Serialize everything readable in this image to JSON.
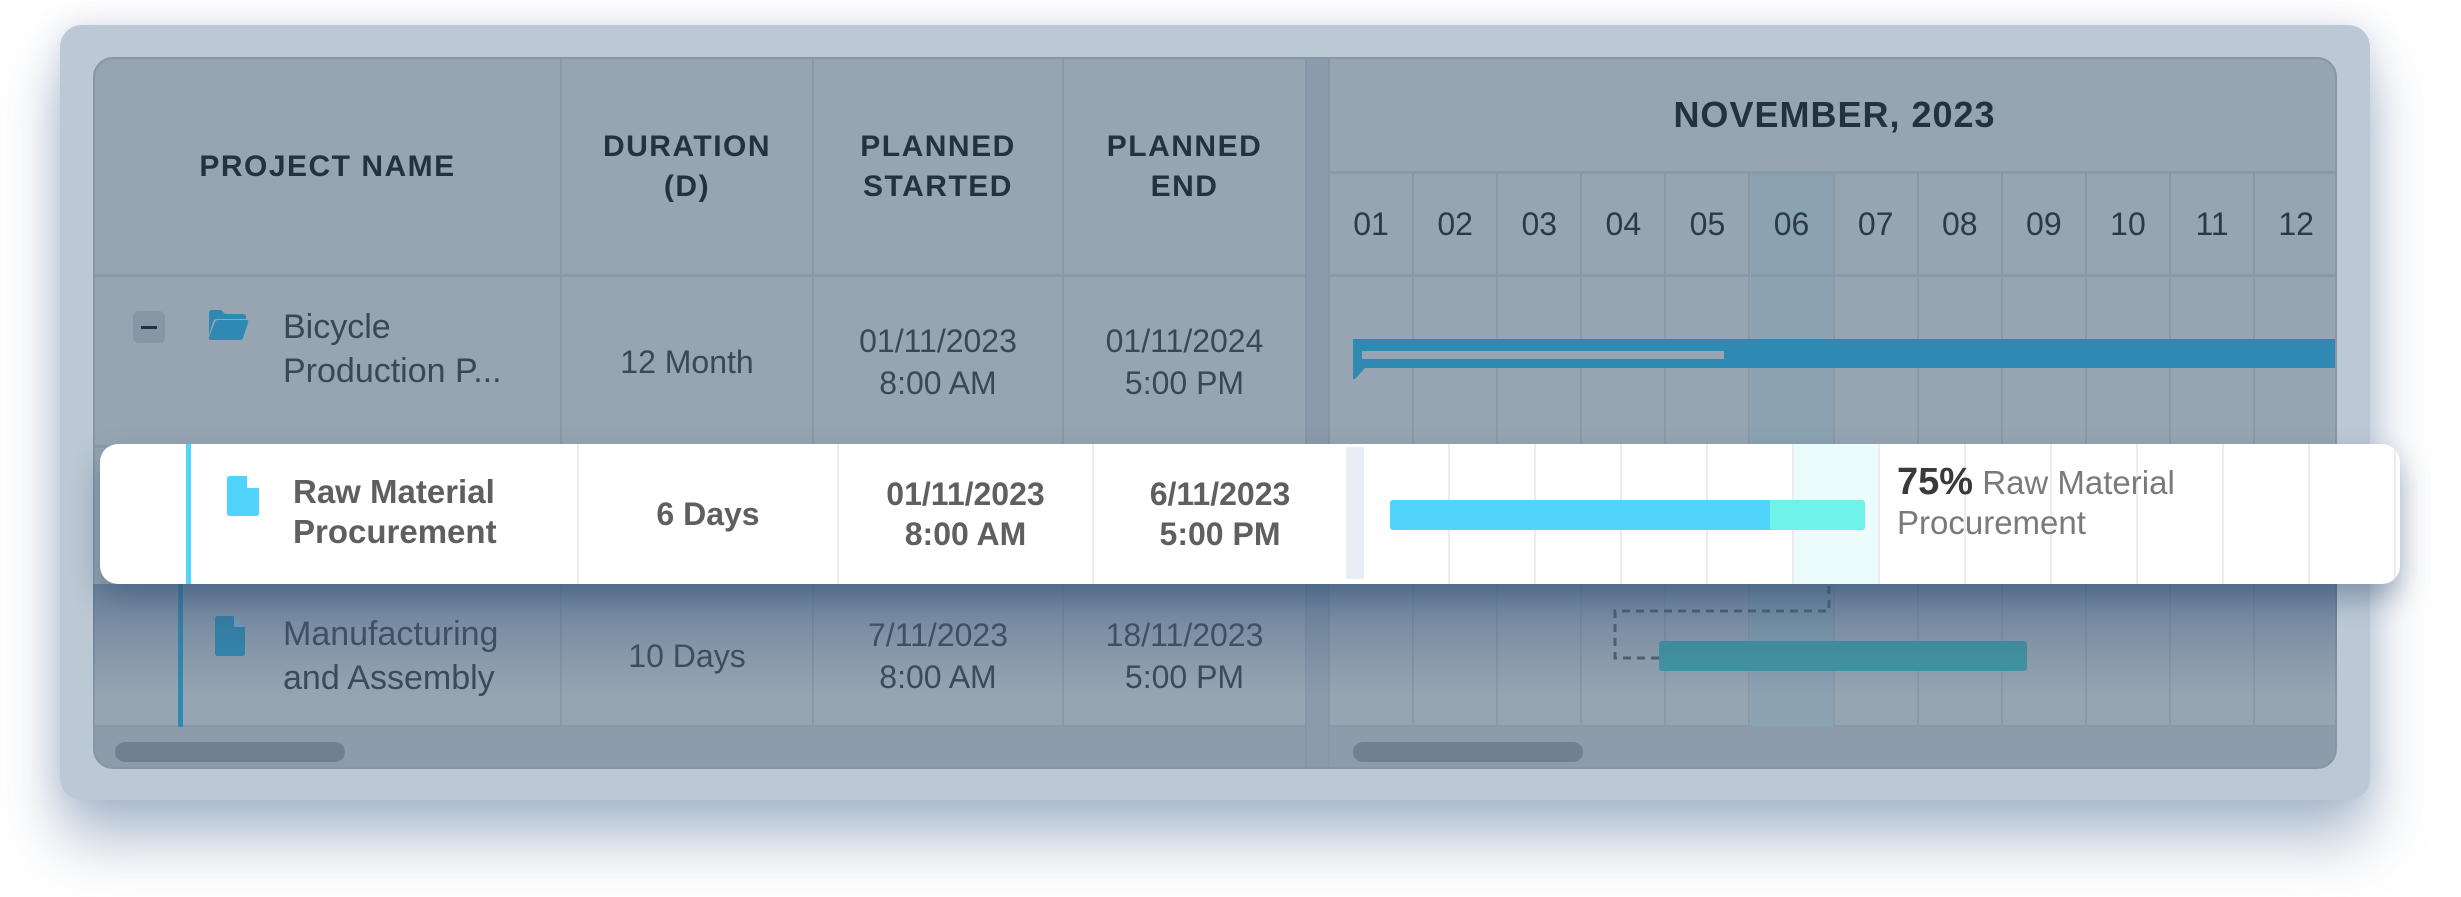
{
  "columns": {
    "project_name": "PROJECT NAME",
    "duration": "DURATION (D)",
    "planned_started": "PLANNED STARTED",
    "planned_end": "PLANNED END"
  },
  "timeline": {
    "month_label": "NOVEMBER, 2023",
    "days": [
      "01",
      "02",
      "03",
      "04",
      "05",
      "06",
      "07",
      "08",
      "09",
      "10",
      "11",
      "12"
    ],
    "today_day": "06"
  },
  "rows": [
    {
      "name_line1": "Bicycle",
      "name_line2": "Production P...",
      "duration": "12 Month",
      "start_date": "01/11/2023",
      "start_time": "8:00 AM",
      "end_date": "01/11/2024",
      "end_time": "5:00 PM",
      "icon": "folder-icon",
      "expanded": true
    },
    {
      "name_line1": "Raw Material",
      "name_line2": "Procurement",
      "duration": "6 Days",
      "start_date": "01/11/2023",
      "start_time": "8:00 AM",
      "end_date": "6/11/2023",
      "end_time": "5:00 PM",
      "icon": "file-icon",
      "progress_percent": 75,
      "progress_label": "75%",
      "bar_label_line1": "Raw Material",
      "bar_label_line2": "Procurement",
      "selected": true
    },
    {
      "name_line1": "Manufacturing",
      "name_line2": "and Assembly",
      "duration": "10 Days",
      "start_date": "7/11/2023",
      "start_time": "8:00 AM",
      "end_date": "18/11/2023",
      "end_time": "5:00 PM",
      "icon": "file-icon"
    }
  ],
  "colors": {
    "summary_bar": "#2e8ab3",
    "task_bar": "#50d4fb",
    "task_bar_remaining": "#6ef2ea",
    "task_bar_dim": "#3e98a4",
    "accent": "#50d4fb"
  }
}
